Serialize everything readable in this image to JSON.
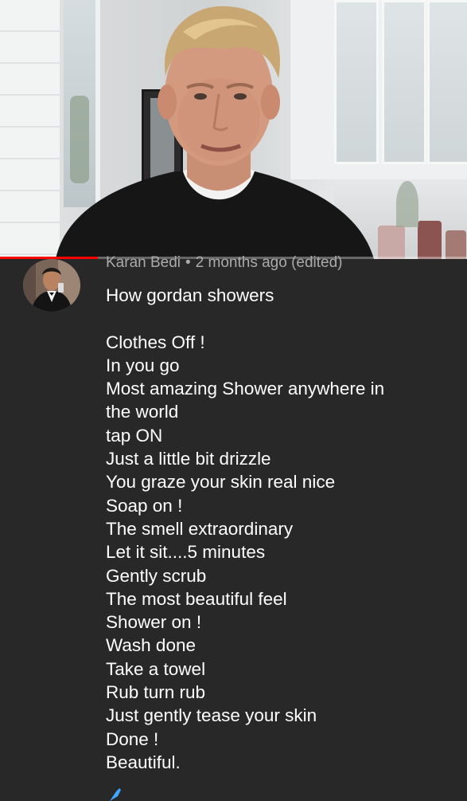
{
  "video": {
    "progress": 0.21
  },
  "comment": {
    "author": "Karan Bedi",
    "separator": "•",
    "timestamp": "2 months ago (edited)",
    "title_line": "How gordan showers",
    "lines": [
      "Clothes Off !",
      "In you go",
      "Most amazing Shower anywhere in",
      "the world",
      "tap ON",
      "Just a little bit drizzle",
      "You graze your skin real nice",
      "Soap on !",
      "The smell extraordinary",
      "Let it sit....5 minutes",
      "Gently scrub",
      "The most beautiful feel",
      "Shower on !",
      "Wash done",
      "Take a towel",
      "Rub turn rub",
      "Just gently tease your skin",
      "Done !",
      "Beautiful."
    ]
  },
  "icons": {
    "avatar": "avatar",
    "like": "thumbs-up-icon"
  },
  "colors": {
    "background": "#282828",
    "progress": "#ff0000",
    "meta_text": "#aaaaaa",
    "body_text": "#ffffff",
    "like_icon": "#3ea6ff"
  }
}
